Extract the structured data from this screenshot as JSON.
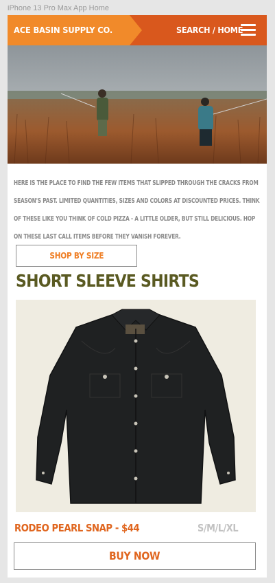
{
  "artboard": {
    "label": "iPhone 13 Pro Max App Home"
  },
  "header": {
    "brand": "ACE BASIN SUPPLY CO.",
    "nav_link": "SEARCH / HOME",
    "menu_icon": "hamburger-menu-icon",
    "colors": {
      "left": "#f18a2a",
      "right": "#d9581d"
    }
  },
  "hero": {
    "image": "two-anglers-fly-fishing-in-marsh-grass"
  },
  "intro": {
    "text": "Here is the place to find the few items that slipped through the cracks from season's past. Limited quantities, sizes and colors at discounted prices. Think of these like you think of cold pizza - a little older, but still delicious. Hop on these last call items before they vanish forever."
  },
  "shop_by_size": {
    "label": "SHOP BY SIZE"
  },
  "section": {
    "title": "SHORT SLEEVE SHIRTS"
  },
  "product": {
    "image": "black-western-pearl-snap-shirt",
    "name_price": "RODEO PEARL SNAP - $44",
    "sizes": "S/M/L/XL",
    "buy_label": "BUY NOW"
  }
}
